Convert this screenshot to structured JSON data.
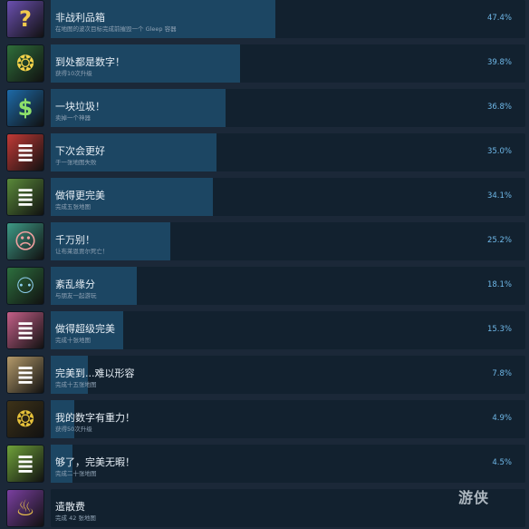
{
  "achievements": [
    {
      "title": "非战利品箱",
      "desc": "在地图的波次目标完成前摧毁一个 Gleep 容器",
      "percent": "47.4%",
      "value": 47.4,
      "icon": "loot-box-icon",
      "icon_bg": "#6a4fb0",
      "glyph": "?",
      "glyph_color": "#f2c94c"
    },
    {
      "title": "到处都是数字！",
      "desc": "获得10次升级",
      "percent": "39.8%",
      "value": 39.8,
      "icon": "balloon-icon",
      "icon_bg": "#2f6e3a",
      "glyph": "❂",
      "glyph_color": "#f5d34a"
    },
    {
      "title": "一块垃圾！",
      "desc": "卖掉一个神器",
      "percent": "36.8%",
      "value": 36.8,
      "icon": "dollar-icon",
      "icon_bg": "#1d6aa8",
      "glyph": "$",
      "glyph_color": "#8ee06a"
    },
    {
      "title": "下次会更好",
      "desc": "于一张地图失败",
      "percent": "35.0%",
      "value": 35.0,
      "icon": "list-red-icon",
      "icon_bg": "#c23a36",
      "glyph": "≣",
      "glyph_color": "#ffffff"
    },
    {
      "title": "做得更完美",
      "desc": "完成五张地图",
      "percent": "34.1%",
      "value": 34.1,
      "icon": "list-green-icon",
      "icon_bg": "#5a8a3a",
      "glyph": "≣",
      "glyph_color": "#ffffff"
    },
    {
      "title": "千万别！",
      "desc": "让布莱恩贾尔死亡！",
      "percent": "25.2%",
      "value": 25.2,
      "icon": "monster-face-icon",
      "icon_bg": "#3e9a86",
      "glyph": "☹",
      "glyph_color": "#f2a0a0"
    },
    {
      "title": "紊乱缘分",
      "desc": "与朋友一起游玩",
      "percent": "18.1%",
      "value": 18.1,
      "icon": "friends-icon",
      "icon_bg": "#2d6f3e",
      "glyph": "⚇",
      "glyph_color": "#8fd0ef"
    },
    {
      "title": "做得超级完美",
      "desc": "完成十张地图",
      "percent": "15.3%",
      "value": 15.3,
      "icon": "list-pink-icon",
      "icon_bg": "#c45f88",
      "glyph": "≣",
      "glyph_color": "#ffffff"
    },
    {
      "title": "完美到...难以形容",
      "desc": "完成十五张地图",
      "percent": "7.8%",
      "value": 7.8,
      "icon": "list-beige-icon",
      "icon_bg": "#b49a6a",
      "glyph": "≣",
      "glyph_color": "#ffffff"
    },
    {
      "title": "我的数字有重力！",
      "desc": "获得50次升级",
      "percent": "4.9%",
      "value": 4.9,
      "icon": "balloons-icon",
      "icon_bg": "#3d3218",
      "glyph": "❂",
      "glyph_color": "#e6c13a"
    },
    {
      "title": "够了，完美无暇！",
      "desc": "完成二十张地图",
      "percent": "4.5%",
      "value": 4.5,
      "icon": "list-lime-icon",
      "icon_bg": "#6fa23a",
      "glyph": "≣",
      "glyph_color": "#ffffff"
    },
    {
      "title": "遣散费",
      "desc": "完成 42 张地图",
      "percent": "",
      "value": 0,
      "icon": "cake-icon",
      "icon_bg": "#7a3fa0",
      "glyph": "♨",
      "glyph_color": "#f2c94c"
    }
  ],
  "watermark": "游侠"
}
